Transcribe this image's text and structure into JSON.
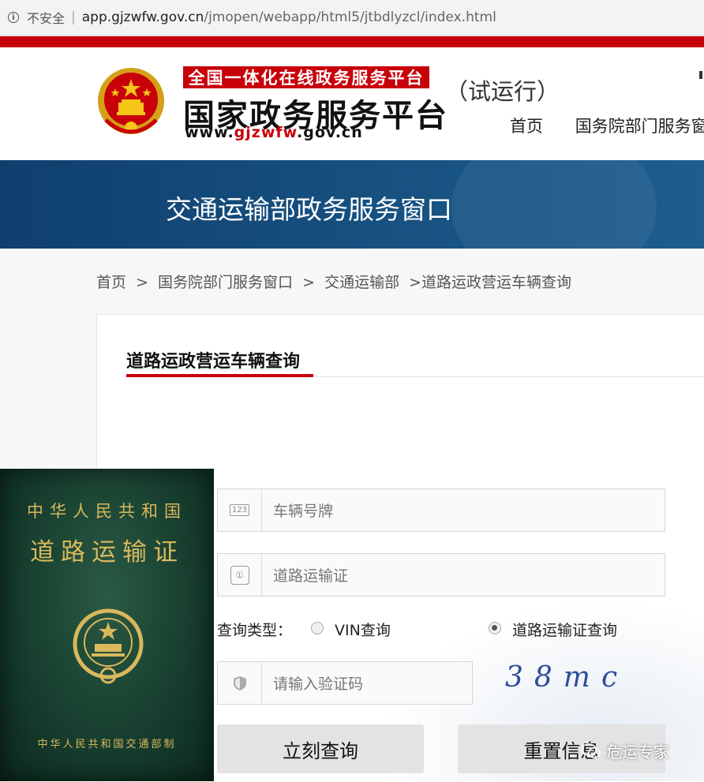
{
  "browser": {
    "insecure_label": "不安全",
    "url_domain": "app.gjzwfw.gov.cn",
    "url_path": "/jmopen/webapp/html5/jtbdlyzcl/index.html"
  },
  "header": {
    "logo_red_text": "全国一体化在线政务服务平台",
    "logo_main_text": "国家政务服务平台",
    "logo_url_prefix": "www.",
    "logo_url_red": "gjzwfw",
    "logo_url_suffix": ".gov.cn",
    "trial_text": "（试运行）",
    "nav": [
      "首页",
      "国务院部门服务窗口"
    ]
  },
  "banner": {
    "title": "交通运输部政务服务窗口"
  },
  "breadcrumb": [
    "首页",
    ">",
    "国务院部门服务窗口",
    ">",
    "交通运输部",
    ">道路运政营运车辆查询"
  ],
  "form": {
    "title": "道路运政营运车辆查询",
    "plate_placeholder": "车辆号牌",
    "license_placeholder": "道路运输证",
    "query_type_label": "查询类型：",
    "radio_vin": "VIN查询",
    "radio_license": "道路运输证查询",
    "selected_radio": "道路运输证查询",
    "captcha_placeholder": "请输入验证码",
    "captcha_text": "38mc",
    "query_button": "立刻查询",
    "reset_button": "重置信息"
  },
  "photo": {
    "top_text": "中华人民共和国",
    "main_text": "道路运输证",
    "bottom_text": "中华人民共和国交通部制"
  },
  "watermark": {
    "text": "危运专家"
  },
  "colors": {
    "brand_red": "#c8000a",
    "banner_blue": "#124a7a",
    "cert_gold": "#d9b85c",
    "cert_green": "#1a4433"
  }
}
